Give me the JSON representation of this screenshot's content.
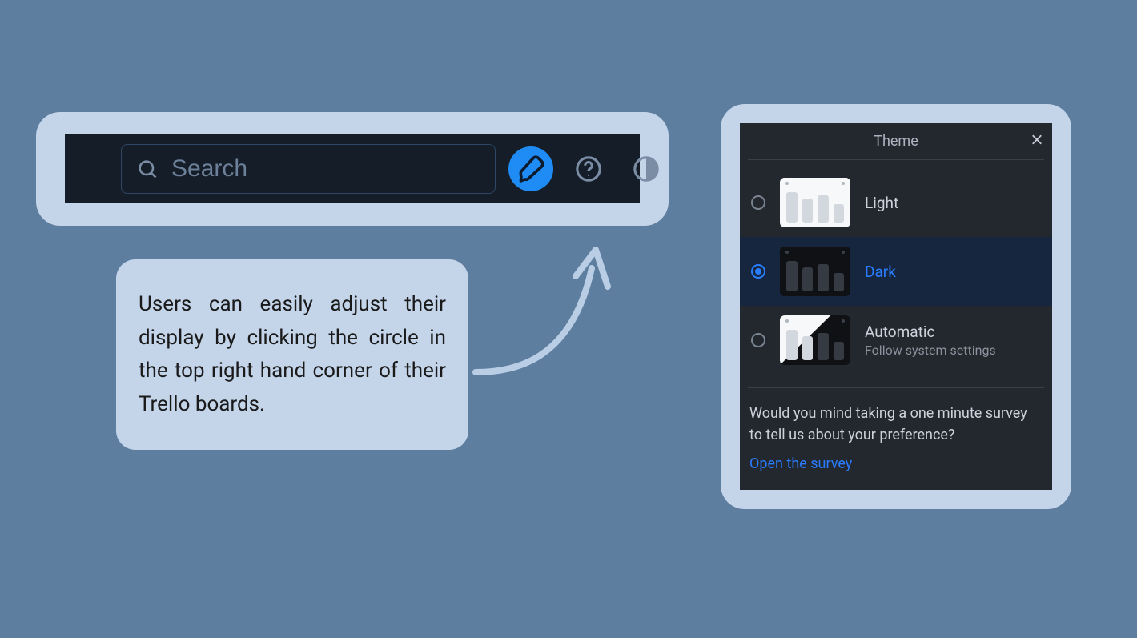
{
  "toolbar": {
    "search_placeholder": "Search"
  },
  "caption": {
    "text": "Users can easily adjust their display by clicking the circle in the top right hand corner of their Trello boards."
  },
  "theme_panel": {
    "title": "Theme",
    "options": [
      {
        "label": "Light",
        "sub": "",
        "selected": false
      },
      {
        "label": "Dark",
        "sub": "",
        "selected": true
      },
      {
        "label": "Automatic",
        "sub": "Follow system settings",
        "selected": false
      }
    ],
    "survey_prompt": "Would you mind taking a one minute survey to tell us about your preference?",
    "survey_link": "Open the survey"
  },
  "colors": {
    "accent_blue": "#2a7dff",
    "button_blue": "#1f8cf5",
    "panel_bg": "#23272e",
    "frame_bg": "#c4d5ea",
    "page_bg": "#5e7ea0"
  }
}
